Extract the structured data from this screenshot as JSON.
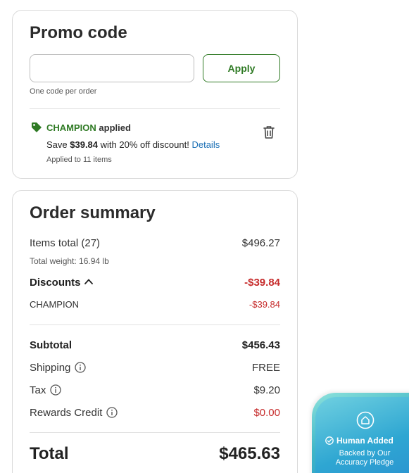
{
  "promo": {
    "title": "Promo code",
    "input_value": "",
    "input_placeholder": "",
    "apply_label": "Apply",
    "helper": "One code per order",
    "applied_code": "CHAMPION",
    "applied_word": "applied",
    "save_prefix": "Save ",
    "save_amount": "$39.84",
    "save_suffix": " with 20% off discount! ",
    "details_label": "Details",
    "applied_items": "Applied to 11 items"
  },
  "summary": {
    "title": "Order summary",
    "items_total_label": "Items total (27)",
    "items_total_value": "$496.27",
    "total_weight": "Total weight: 16.94 lb",
    "discounts_label": "Discounts",
    "discounts_value": "-$39.84",
    "discount_code_label": "CHAMPION",
    "discount_code_value": "-$39.84",
    "subtotal_label": "Subtotal",
    "subtotal_value": "$456.43",
    "shipping_label": "Shipping",
    "shipping_value": "FREE",
    "tax_label": "Tax",
    "tax_value": "$9.20",
    "rewards_label": "Rewards Credit",
    "rewards_value": "$0.00",
    "total_label": "Total",
    "total_value": "$465.63"
  },
  "badge": {
    "title": "Human Added",
    "subtitle": "Backed by Our Accuracy Pledge"
  },
  "colors": {
    "brand_green": "#2f7a24",
    "discount_red": "#c62b2b",
    "link_blue": "#1a6fb5"
  },
  "icons": {
    "tag": "tag-icon",
    "trash": "trash-icon",
    "chevron": "chevron-up-icon",
    "info": "info-icon",
    "shield": "shield-icon",
    "check": "check-circle-icon"
  }
}
